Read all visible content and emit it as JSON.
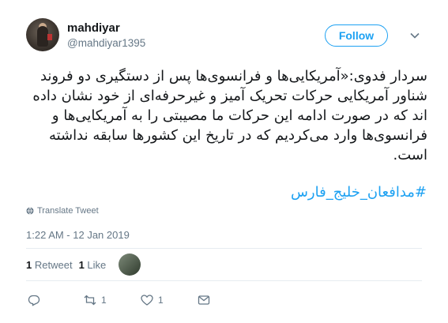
{
  "tweet": {
    "display_name": "mahdiyar",
    "handle": "@mahdiyar1395",
    "follow_label": "Follow",
    "text": "سردار فدوی:«آمریکایی‌ها و فرانسوی‌ها پس از دستگیری دو فروند شناور آمریکایی حرکات تحریک آمیز و غیرحرفه‌ای از خود نشان داده اند که در صورت ادامه این حرکات ما مصیبتی را به آمریکایی‌ها و فرانسوی‌ها وارد می‌کردیم که در تاریخ این کشورها سابقه نداشته است.",
    "hashtag": "#مدافعان_خلیج_فارس",
    "translate_label": "Translate Tweet",
    "timestamp": "1:22 AM - 12 Jan 2019",
    "stats": {
      "retweets_count": "1",
      "retweets_label": "Retweet",
      "likes_count": "1",
      "likes_label": "Like"
    },
    "actions": {
      "reply_count": "",
      "retweet_count": "1",
      "like_count": "1"
    }
  },
  "colors": {
    "accent": "#1da1f2",
    "muted": "#657786",
    "text": "#14171a"
  },
  "icons": [
    "reply-icon",
    "retweet-icon",
    "like-icon",
    "message-icon",
    "globe-icon",
    "chevron-down-icon"
  ]
}
